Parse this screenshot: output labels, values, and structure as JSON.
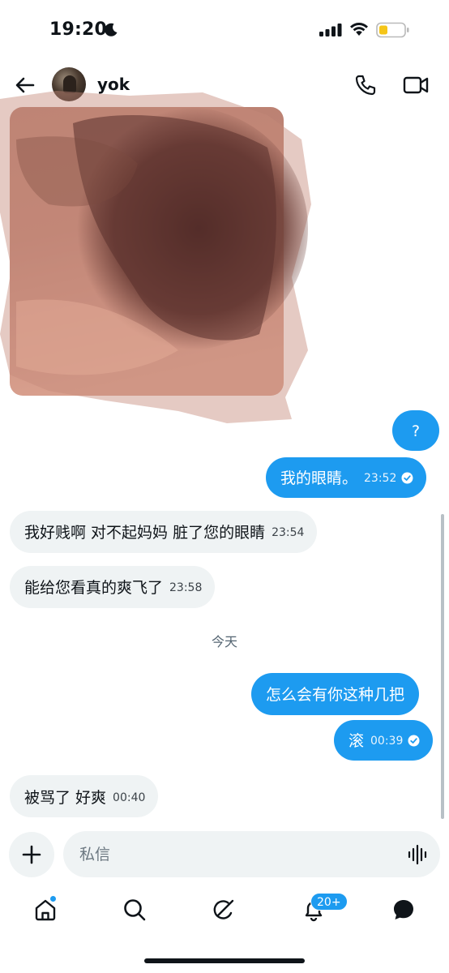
{
  "status_bar": {
    "time": "19:20",
    "icons": [
      "moon-icon",
      "signal-icon",
      "wifi-icon",
      "battery-icon"
    ]
  },
  "header": {
    "contact_name": "yok",
    "icons": [
      "back-arrow-icon",
      "phone-icon",
      "video-camera-icon"
    ]
  },
  "colors": {
    "accent": "#1d9bf0",
    "incoming_bubble": "#eff3f4",
    "text": "#0f1419",
    "muted": "#536471"
  },
  "messages": [
    {
      "direction": "in",
      "type": "image",
      "text": ""
    },
    {
      "direction": "out",
      "text": "?",
      "time": ""
    },
    {
      "direction": "out",
      "text": "我的眼睛。",
      "time": "23:52",
      "read": true
    },
    {
      "direction": "in",
      "text": "我好贱啊 对不起妈妈 脏了您的眼睛",
      "time": "23:54"
    },
    {
      "direction": "in",
      "text": "能给您看真的爽飞了",
      "time": "23:58"
    },
    {
      "direction": "out",
      "text": "怎么会有你这种几把",
      "time": ""
    },
    {
      "direction": "out",
      "text": "滚",
      "time": "00:39",
      "read": true
    },
    {
      "direction": "in",
      "text": "被骂了 好爽",
      "time": "00:40"
    }
  ],
  "date_separator": "今天",
  "composer": {
    "placeholder": "私信",
    "value": ""
  },
  "bottom_nav": {
    "items": [
      "home",
      "search",
      "grok",
      "notifications",
      "messages"
    ],
    "notifications_badge": "20+"
  }
}
